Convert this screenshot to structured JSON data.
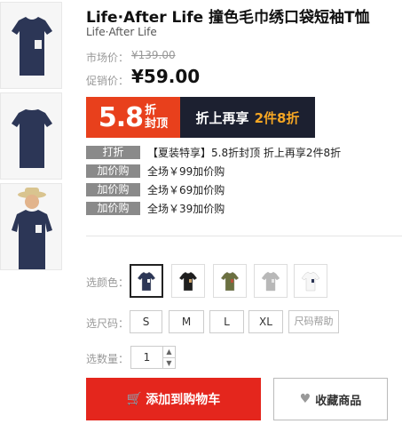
{
  "product": {
    "title": "Life·After Life 撞色毛巾绣口袋短袖T恤",
    "brand": "Life·After Life"
  },
  "price": {
    "market_label": "市场价：",
    "market_value": "¥139.00",
    "sale_label": "促销价：",
    "sale_value": "¥59.00"
  },
  "banner": {
    "discount_num": "5.8",
    "discount_top": "折",
    "discount_bottom": "封顶",
    "extra": "折上再享",
    "extra_highlight": "2件8折"
  },
  "promos": [
    {
      "tag": "打折",
      "text": "【夏装特享】5.8折封顶 折上再享2件8折"
    },
    {
      "tag": "加价购",
      "text": "全场￥99加价购"
    },
    {
      "tag": "加价购",
      "text": "全场￥69加价购"
    },
    {
      "tag": "加价购",
      "text": "全场￥39加价购"
    }
  ],
  "options": {
    "color_label": "选颜色：",
    "colors": [
      {
        "name": "navy",
        "hex": "#2c3656",
        "pocket": "#f2f2f2"
      },
      {
        "name": "black",
        "hex": "#1e1e1e",
        "pocket": "#c9a26a"
      },
      {
        "name": "olive",
        "hex": "#6b7040",
        "pocket": "#b8503a"
      },
      {
        "name": "grey",
        "hex": "#b8b8b8",
        "pocket": "#e6e6e6"
      },
      {
        "name": "white",
        "hex": "#f7f7f7",
        "pocket": "#2c3656"
      }
    ],
    "size_label": "选尺码：",
    "sizes": [
      "S",
      "M",
      "L",
      "XL"
    ],
    "size_help": "尺码帮助",
    "qty_label": "选数量：",
    "qty_value": "1"
  },
  "actions": {
    "add_to_cart": "添加到购物车",
    "favorite": "收藏商品"
  },
  "icons": {
    "cart": "cart-icon",
    "heart": "heart-icon"
  }
}
